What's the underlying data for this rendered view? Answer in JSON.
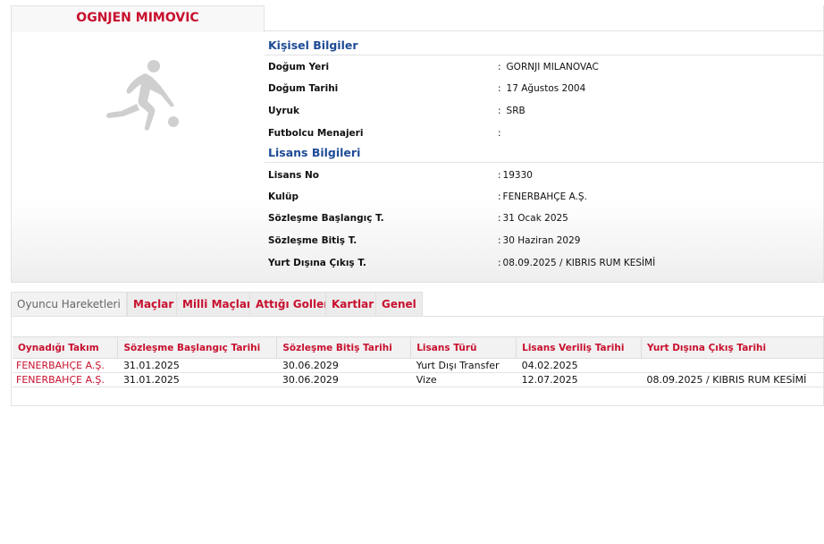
{
  "player": {
    "name": "OGNJEN MIMOVIC"
  },
  "personal": {
    "title": "Kişisel Bilgiler",
    "rows": [
      {
        "label": "Doğum Yeri",
        "colon": ":",
        "value": "GORNJI MILANOVAC"
      },
      {
        "label": "Doğum Tarihi",
        "colon": ":",
        "value": "17 Ağustos 2004"
      },
      {
        "label": "Uyruk",
        "colon": ":",
        "value": "SRB"
      },
      {
        "label": "Futbolcu Menajeri",
        "colon": ":",
        "value": ""
      }
    ]
  },
  "license": {
    "title": "Lisans Bilgileri",
    "rows": [
      {
        "label": "Lisans No",
        "colon": ":",
        "value": "19330"
      },
      {
        "label": "Kulüp",
        "colon": ":",
        "value": "FENERBAHÇE A.Ş."
      },
      {
        "label": "Sözleşme Başlangıç T.",
        "colon": ":",
        "value": "31 Ocak 2025"
      },
      {
        "label": "Sözleşme Bitiş T.",
        "colon": ":",
        "value": "30 Haziran 2029"
      },
      {
        "label": "Yurt Dışına Çıkış T.",
        "colon": ":",
        "value": "08.09.2025 / KIBRIS RUM KESİMİ"
      }
    ]
  },
  "tabs": [
    {
      "label": "Oyuncu Hareketleri",
      "active": true
    },
    {
      "label": "Maçlar",
      "active": false
    },
    {
      "label": "Milli Maçlar",
      "active": false
    },
    {
      "label": "Attığı Goller",
      "active": false
    },
    {
      "label": "Kartlar",
      "active": false
    },
    {
      "label": "Genel",
      "active": false
    }
  ],
  "movements": {
    "headers": [
      "Oynadığı Takım",
      "Sözleşme Başlangıç Tarihi",
      "Sözleşme Bitiş Tarihi",
      "Lisans Türü",
      "Lisans Veriliş Tarihi",
      "Yurt Dışına Çıkış Tarihi"
    ],
    "rows": [
      [
        "FENERBAHÇE A.Ş.",
        "31.01.2025",
        "30.06.2029",
        "Yurt Dışı Transfer",
        "04.02.2025",
        ""
      ],
      [
        "FENERBAHÇE A.Ş.",
        "31.01.2025",
        "30.06.2029",
        "Vize",
        "12.07.2025",
        "08.09.2025 / KIBRIS RUM KESİMİ"
      ]
    ]
  },
  "colors": {
    "accent_red": "#c8102e",
    "section_blue": "#1e4b96",
    "silhouette_gray": "#cfcfcf"
  },
  "icons": {
    "photo_placeholder": "soccer-player-silhouette-icon"
  }
}
